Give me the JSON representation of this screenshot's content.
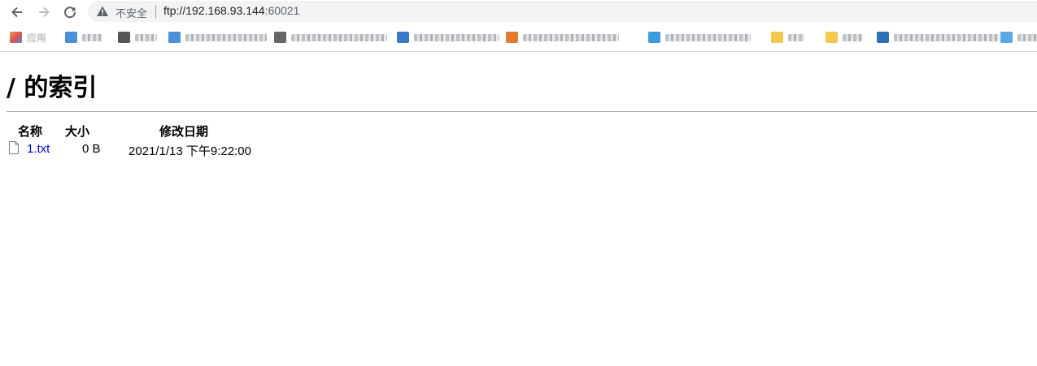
{
  "browser": {
    "security_label": "不安全",
    "url_host": "ftp://192.168.93.144",
    "url_port": ":60021",
    "bookmarks": [
      {
        "label": "应用",
        "icon_color": "#e8a040"
      },
      {
        "label": "",
        "icon_color": "#4a90d9"
      },
      {
        "label": "",
        "icon_color": "#555555"
      },
      {
        "label": "",
        "icon_color": "#4a90d9"
      },
      {
        "label": "",
        "icon_color": "#666666"
      },
      {
        "label": "",
        "icon_color": "#3b78c9"
      },
      {
        "label": "",
        "icon_color": "#e07a2e"
      },
      {
        "label": "",
        "icon_color": "#3b9be0"
      },
      {
        "label": "",
        "icon_color": "#f2c94c"
      },
      {
        "label": "",
        "icon_color": "#f2c94c"
      },
      {
        "label": "",
        "icon_color": "#2f6fb3"
      },
      {
        "label": "",
        "icon_color": "#5aa9e6"
      }
    ]
  },
  "page": {
    "title": "/ 的索引",
    "columns": {
      "name": "名称",
      "size": "大小",
      "modified": "修改日期"
    },
    "files": [
      {
        "name": "1.txt",
        "size": "0 B",
        "modified": "2021/1/13 下午9:22:00",
        "icon": "file-icon"
      }
    ]
  },
  "colors": {
    "link": "#0000ee",
    "omnibox_bg": "#f1f3f4"
  }
}
